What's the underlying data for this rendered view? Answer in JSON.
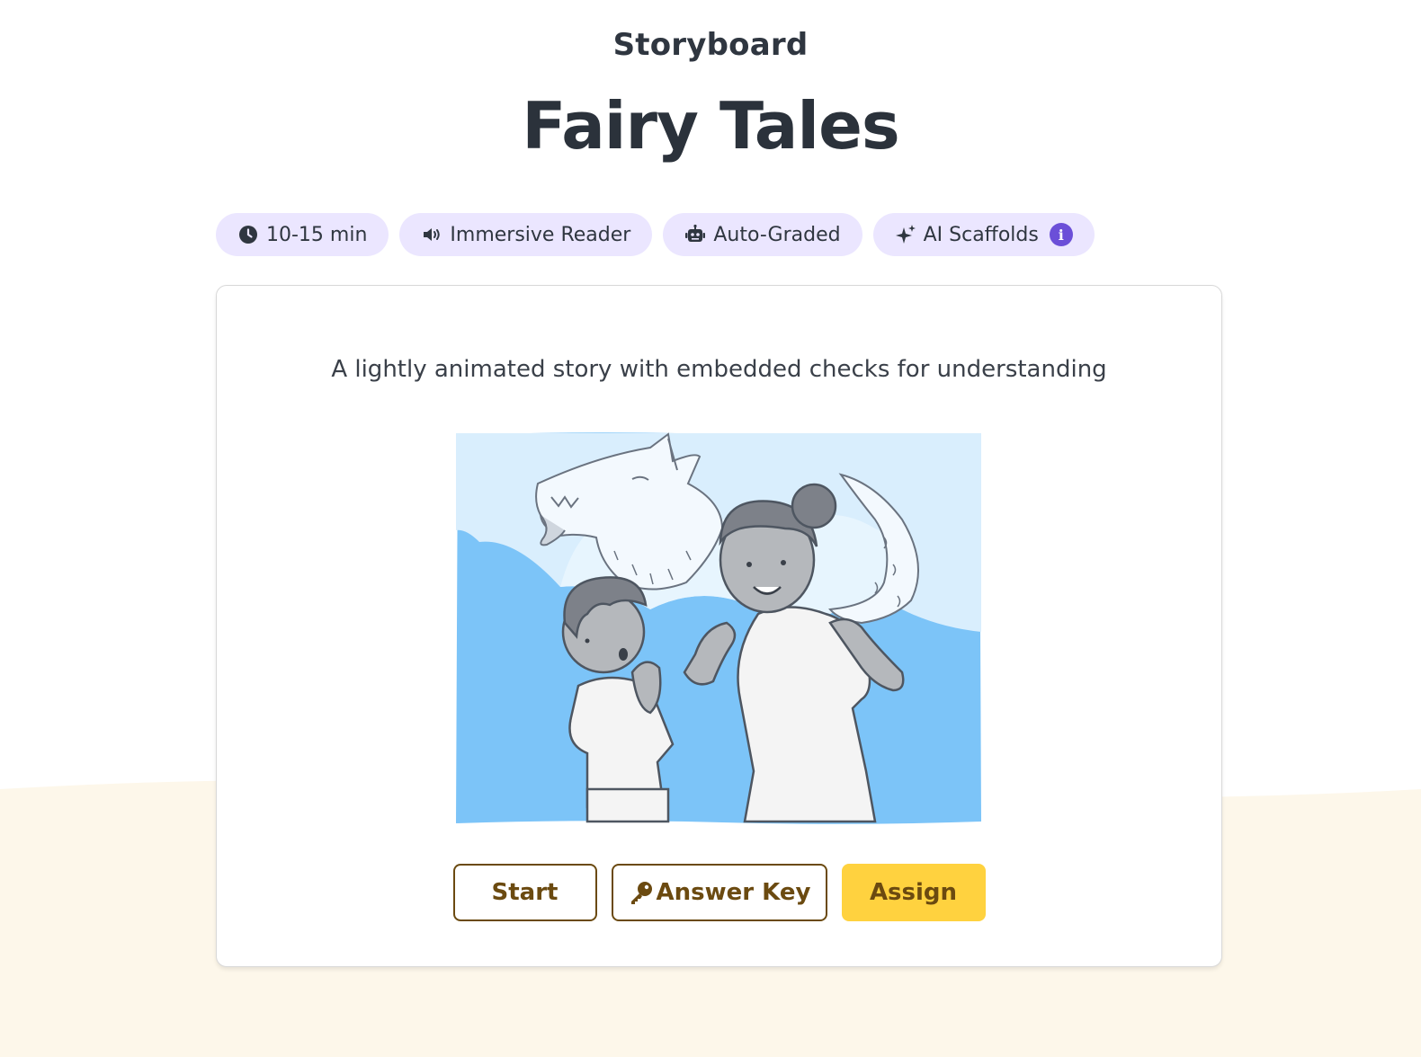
{
  "header": {
    "eyebrow": "Storyboard",
    "title": "Fairy Tales"
  },
  "badges": [
    {
      "label": "10-15 min",
      "icon": "clock-icon"
    },
    {
      "label": "Immersive Reader",
      "icon": "speaker-icon"
    },
    {
      "label": "Auto-Graded",
      "icon": "robot-icon"
    },
    {
      "label": "AI Scaffolds",
      "icon": "sparkles-icon",
      "info_icon": "info-icon"
    }
  ],
  "card": {
    "description": "A lightly animated story with embedded checks for understanding",
    "illustration": "wolf-and-storyteller-illustration",
    "buttons": {
      "start": "Start",
      "answer_key": "Answer Key",
      "answer_key_icon": "key-icon",
      "assign": "Assign"
    }
  },
  "colors": {
    "badge_bg": "#ebe6ff",
    "accent_purple": "#6b4fd8",
    "button_brown": "#6b4a10",
    "assign_yellow": "#ffd23f",
    "footer_cream": "#fdf7ea"
  }
}
